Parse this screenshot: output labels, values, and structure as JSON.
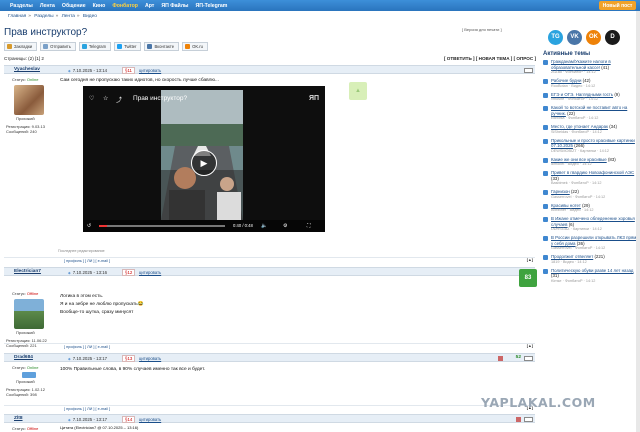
{
  "nav": {
    "items": [
      "Разделы",
      "Лента",
      "Общение",
      "Кино",
      "Фонбатор",
      "Арт",
      "ЯП Файлы",
      "ЯП-Telegram"
    ],
    "highlight": "Фонбатор",
    "login": "Новый пост"
  },
  "breadcrumb": [
    "Главная",
    "Разделы",
    "Лента",
    "Видео"
  ],
  "thread": {
    "title": "Прав инструктор?",
    "versions": "[ Версия для печати ]",
    "pages_label": "Страницы: (2) [1] 2",
    "actions": "[ ОТВЕТИТЬ ] [ НОВАЯ ТЕМА ] [ ОПРОС ]"
  },
  "share": [
    {
      "label": "Закладки",
      "color": "#d89a2b"
    },
    {
      "label": "Отправить",
      "color": "#7aa0c8"
    },
    {
      "label": "Telegram",
      "color": "#2aa3df"
    },
    {
      "label": "Twitter",
      "color": "#1da1f2"
    },
    {
      "label": "Вконтакте",
      "color": "#4a76a8"
    },
    {
      "label": "OK.ru",
      "color": "#ee8208"
    }
  ],
  "posts": [
    {
      "nick": "Vyacheslav",
      "date": "7.10.2025 - 13:14",
      "num": "§11",
      "quote": "цитировать",
      "status_label": "Статус:",
      "status": "Online",
      "rank": "Прохожий",
      "reg": "Регистрация: 9.03.13",
      "msgs": "Сообщений: 240",
      "text": "Сам сегодня не пропускаю таких идиотов, но скорость лучше сбавлю...",
      "edit": "Последнее редактирование",
      "links": "[ профиль ] [ ЛИ ] [ e-mail ]"
    },
    {
      "nick": "Electrician7",
      "date": "7.10.2025 - 13:16",
      "num": "§12",
      "quote": "цитировать",
      "status_label": "Статус:",
      "status": "Offline",
      "rank": "Прохожий",
      "reg": "Регистрация: 11.06.22",
      "msgs": "Сообщений: 221",
      "rating": "83",
      "lines": [
        "Логика в этом есть.",
        "Я и на зебре не люблю пропускать😂",
        "Вообще-то шутка, сразу минусят"
      ],
      "links": "[ профиль ] [ ЛИ ] [ e-mail ]"
    },
    {
      "nick": "Drad684",
      "date": "7.10.2025 - 13:17",
      "num": "§13",
      "quote": "цитировать",
      "status_label": "Статус:",
      "status": "Online",
      "rank": "Прохожий",
      "reg": "Регистрация: 1.02.12",
      "msgs": "Сообщений: 398",
      "count": "52",
      "text": "100% Правильные слова, в 90% случаев именно так все и будет.",
      "links": "[ профиль ] [ ЛИ ] [ e-mail ]"
    },
    {
      "nick": "Zlt8",
      "date": "7.10.2025 - 13:17",
      "num": "§14",
      "quote": "цитировать",
      "status_label": "Статус:",
      "status": "Offline",
      "text": "Цитата (Electrician7 @ 07.10.2025 – 13:16)"
    }
  ],
  "video": {
    "title": "Прав инструктор?",
    "time": "0:40 / 0:48"
  },
  "sidebar": {
    "title": "Активные темы",
    "social": [
      "TG",
      "VK",
      "OK",
      "D"
    ],
    "topics": [
      {
        "title": "Гражданам/Укажите налоги в образовательной кассе!",
        "count": "(41)",
        "meta": "ZuZao · ФонбатоР · 14:12"
      },
      {
        "title": "Рабочие будни",
        "count": "(42)",
        "meta": "RooBotan · Видео · 14:12"
      },
      {
        "title": "ЕГЭ и ОГЭ. Наглядными гость",
        "count": "(9)",
        "meta": "vmoshe · ФонбатоР · 14:12"
      },
      {
        "title": "Какой то вотской не поставит авто на ручник.",
        "count": "(22)",
        "meta": "Ekbolsa · ФонбатоР · 14:12"
      },
      {
        "title": "Место, где утонает Андарак",
        "count": "(34)",
        "meta": "SiSheidas · ФонбатоР · 14:12"
      },
      {
        "title": "Прикольные и просто красивые картинки 07.10.2025",
        "count": "(266)",
        "meta": "DEWSMOBIZT · Картинки · 14:12"
      },
      {
        "title": "Какие же они все красивые",
        "count": "(83)",
        "meta": "dimobel · Видео · 14:12"
      },
      {
        "title": "Привет в гвардию Новоафонинской АЭС",
        "count": "(33)",
        "meta": "Basbimek · ФонбатоР · 14:12"
      },
      {
        "title": "Гарнизон",
        "count": "(22)",
        "meta": "Gasserrovel · ФонбатоР · 14:12"
      },
      {
        "title": "Красивы нотет",
        "count": "(29)",
        "meta": "Bobbiner · Видео · 14:12"
      },
      {
        "title": "В Ижане отмечено обледенение хоровья случаев",
        "count": "(6)",
        "meta": "DDRSGAZ · Картинки · 14:12"
      },
      {
        "title": "В России разрешили открывать ЛКЗ прямо у себя дома",
        "count": "(36)",
        "meta": "Gasserrovel · ФонбатоР · 14:12"
      },
      {
        "title": "Продолжит отвеляет",
        "count": "(221)",
        "meta": "1819 · Видео · 14:12"
      },
      {
        "title": "Политическую обуви разве 14 лет назад",
        "count": "(31)",
        "meta": "Kimse · ФонбатоР · 14:12"
      },
      {
        "title": "",
        "count": "",
        "meta": ""
      }
    ]
  },
  "watermark": "YAPLAKAL.COM"
}
